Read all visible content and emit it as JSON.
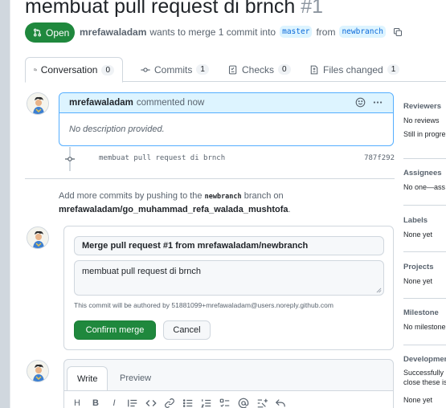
{
  "pr": {
    "title": "membuat pull request di brnch",
    "number": "#1",
    "state": "Open",
    "author": "mrefawaladam",
    "wants_text": "wants to merge 1 commit into",
    "base_branch": "master",
    "from_text": "from",
    "head_branch": "newbranch"
  },
  "tabs": [
    {
      "label": "Conversation",
      "count": "0"
    },
    {
      "label": "Commits",
      "count": "1"
    },
    {
      "label": "Checks",
      "count": "0"
    },
    {
      "label": "Files changed",
      "count": "1"
    }
  ],
  "comment": {
    "author": "mrefawaladam",
    "action": "commented now",
    "body": "No description provided."
  },
  "commit": {
    "message": "membuat pull request di brnch",
    "sha": "787f292"
  },
  "hint": {
    "prefix": "Add more commits by pushing to the",
    "branch": "newbranch",
    "middle": "branch on",
    "repo": "mrefawaladam/go_muhammad_refa_walada_mushtofa",
    "suffix": "."
  },
  "merge": {
    "title_value": "Merge pull request #1 from mrefawaladam/newbranch",
    "body_value": "membuat pull request di brnch",
    "author_note": "This commit will be authored by 51881099+mrefawaladam@users.noreply.github.com",
    "confirm_label": "Confirm merge",
    "cancel_label": "Cancel"
  },
  "editor": {
    "write_label": "Write",
    "preview_label": "Preview"
  },
  "sidebar": {
    "reviewers": {
      "heading": "Reviewers",
      "values": [
        "No reviews",
        "Still in progre"
      ]
    },
    "assignees": {
      "heading": "Assignees",
      "values": [
        "No one—ass"
      ]
    },
    "labels": {
      "heading": "Labels",
      "values": [
        "None yet"
      ]
    },
    "projects": {
      "heading": "Projects",
      "values": [
        "None yet"
      ]
    },
    "milestone": {
      "heading": "Milestone",
      "values": [
        "No milestone"
      ]
    },
    "development": {
      "heading": "Developmen",
      "values": [
        "Successfully",
        "close these is",
        "None yet"
      ]
    }
  },
  "colors": {
    "open_green": "#1f883d",
    "link_blue": "#0969da",
    "comment_header_bg": "#ddf4ff",
    "comment_border": "#54aeff"
  },
  "icons": [
    "git-pull-request-icon",
    "copy-icon",
    "comment-discussion-icon",
    "git-commit-icon",
    "checklist-icon",
    "file-diff-icon",
    "smiley-icon",
    "kebab-horizontal-icon"
  ]
}
